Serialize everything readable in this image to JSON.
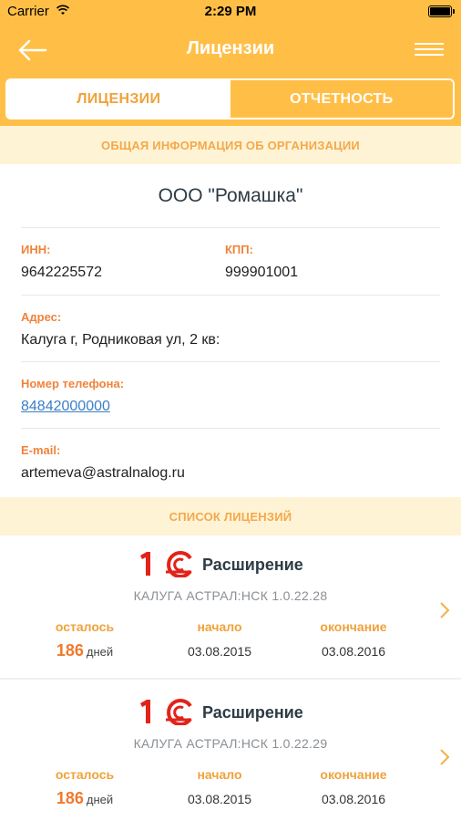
{
  "status_bar": {
    "carrier": "Carrier",
    "time": "2:29 PM"
  },
  "nav": {
    "title": "Лицензии",
    "back_icon": "arrow-left-icon",
    "menu_icon": "hamburger-menu-icon"
  },
  "tabs": [
    {
      "label": "ЛИЦЕНЗИИ",
      "active": true
    },
    {
      "label": "ОТЧЕТНОСТЬ",
      "active": false
    }
  ],
  "org_section": {
    "header": "ОБЩАЯ ИНФОРМАЦИЯ ОБ ОРГАНИЗАЦИИ",
    "name": "ООО \"Ромашка\"",
    "inn_label": "ИНН:",
    "inn": "9642225572",
    "kpp_label": "КПП:",
    "kpp": "999901001",
    "address_label": "Адрес:",
    "address": "Калуга г, Родниковая ул, 2 кв:",
    "phone_label": "Номер телефона:",
    "phone": "84842000000",
    "email_label": "E-mail:",
    "email": "artemeva@astralnalog.ru"
  },
  "licenses_section": {
    "header": "СПИСОК ЛИЦЕНЗИЙ",
    "col_labels": {
      "remaining": "осталось",
      "start": "начало",
      "end": "окончание"
    },
    "days_unit": "дней",
    "items": [
      {
        "title": "Расширение",
        "product": "КАЛУГА АСТРАЛ:НСК 1.0.22.28",
        "days_left": "186",
        "start": "03.08.2015",
        "end": "03.08.2016"
      },
      {
        "title": "Расширение",
        "product": "КАЛУГА АСТРАЛ:НСК 1.0.22.29",
        "days_left": "186",
        "start": "03.08.2015",
        "end": "03.08.2016"
      }
    ]
  },
  "colors": {
    "accent": "#ffbf47",
    "header_bg": "#fff3d6",
    "label_orange": "#f0833a",
    "logo_red": "#e2231a"
  }
}
